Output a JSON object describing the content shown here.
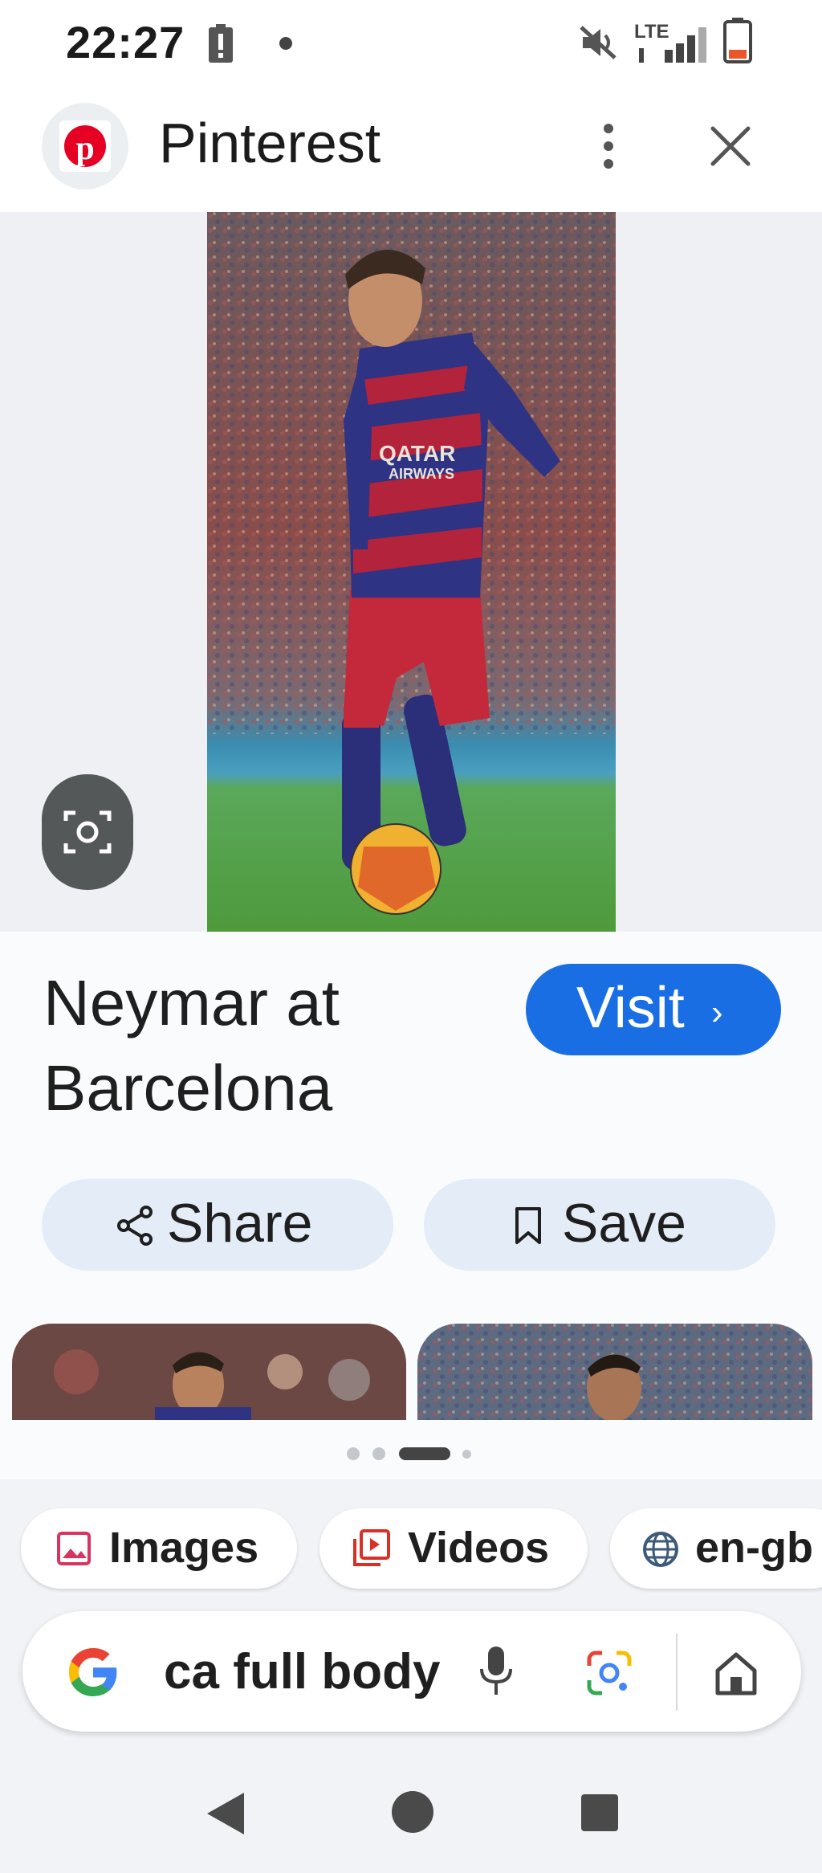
{
  "status_bar": {
    "time": "22:27",
    "icons": [
      "battery-alert-icon",
      "notification-dot-icon",
      "mute-icon",
      "lte-signal-icon",
      "battery-low-icon"
    ],
    "network_label": "LTE"
  },
  "header": {
    "app_name": "Pinterest",
    "logo_icon": "pinterest-logo-icon",
    "menu_icon": "more-vert-icon",
    "close_icon": "close-icon"
  },
  "result": {
    "caption": "Neymar at Barcelona",
    "visit_label": "Visit",
    "share_label": "Share",
    "save_label": "Save",
    "carousel": {
      "count": 4,
      "active_index": 2
    }
  },
  "chips": [
    {
      "label": "Images",
      "icon": "image-icon"
    },
    {
      "label": "Videos",
      "icon": "video-icon"
    },
    {
      "label": "en-gb",
      "icon": "globe-icon"
    }
  ],
  "search": {
    "query_visible": "ca full body",
    "google_icon": "google-g-icon",
    "mic_icon": "microphone-icon",
    "lens_icon": "google-lens-icon",
    "home_icon": "home-icon"
  },
  "colors": {
    "accent": "#1a6ee3",
    "pinterest_red": "#e60023",
    "pill_bg": "#e4ecf8",
    "battery_low": "#e8562a"
  }
}
